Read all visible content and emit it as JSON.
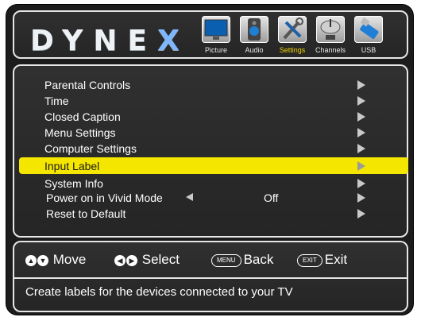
{
  "brand": {
    "logo_main": "DYNE",
    "logo_accent": "X"
  },
  "tabs": [
    {
      "label": "Picture",
      "icon": "monitor-icon"
    },
    {
      "label": "Audio",
      "icon": "speaker-icon"
    },
    {
      "label": "Settings",
      "icon": "tools-icon",
      "active": true
    },
    {
      "label": "Channels",
      "icon": "satellite-dish-icon"
    },
    {
      "label": "USB",
      "icon": "usb-drive-icon"
    }
  ],
  "menu": {
    "items": [
      {
        "label": "Parental Controls"
      },
      {
        "label": "Time"
      },
      {
        "label": "Closed Caption"
      },
      {
        "label": "Menu Settings"
      },
      {
        "label": "Computer Settings"
      },
      {
        "label": "Input Label",
        "selected": true
      },
      {
        "label": "System Info"
      },
      {
        "label": "Power on in Vivid Mode",
        "value": "Off"
      },
      {
        "label": "Reset to Default"
      }
    ]
  },
  "footer": {
    "move_label": "Move",
    "select_label": "Select",
    "back_key": "MENU",
    "back_label": "Back",
    "exit_key": "EXIT",
    "exit_label": "Exit",
    "description": "Create labels for the devices connected to your TV"
  },
  "colors": {
    "highlight": "#f5e600",
    "active_tab": "#f2d400",
    "background": "#1c1c1c"
  }
}
